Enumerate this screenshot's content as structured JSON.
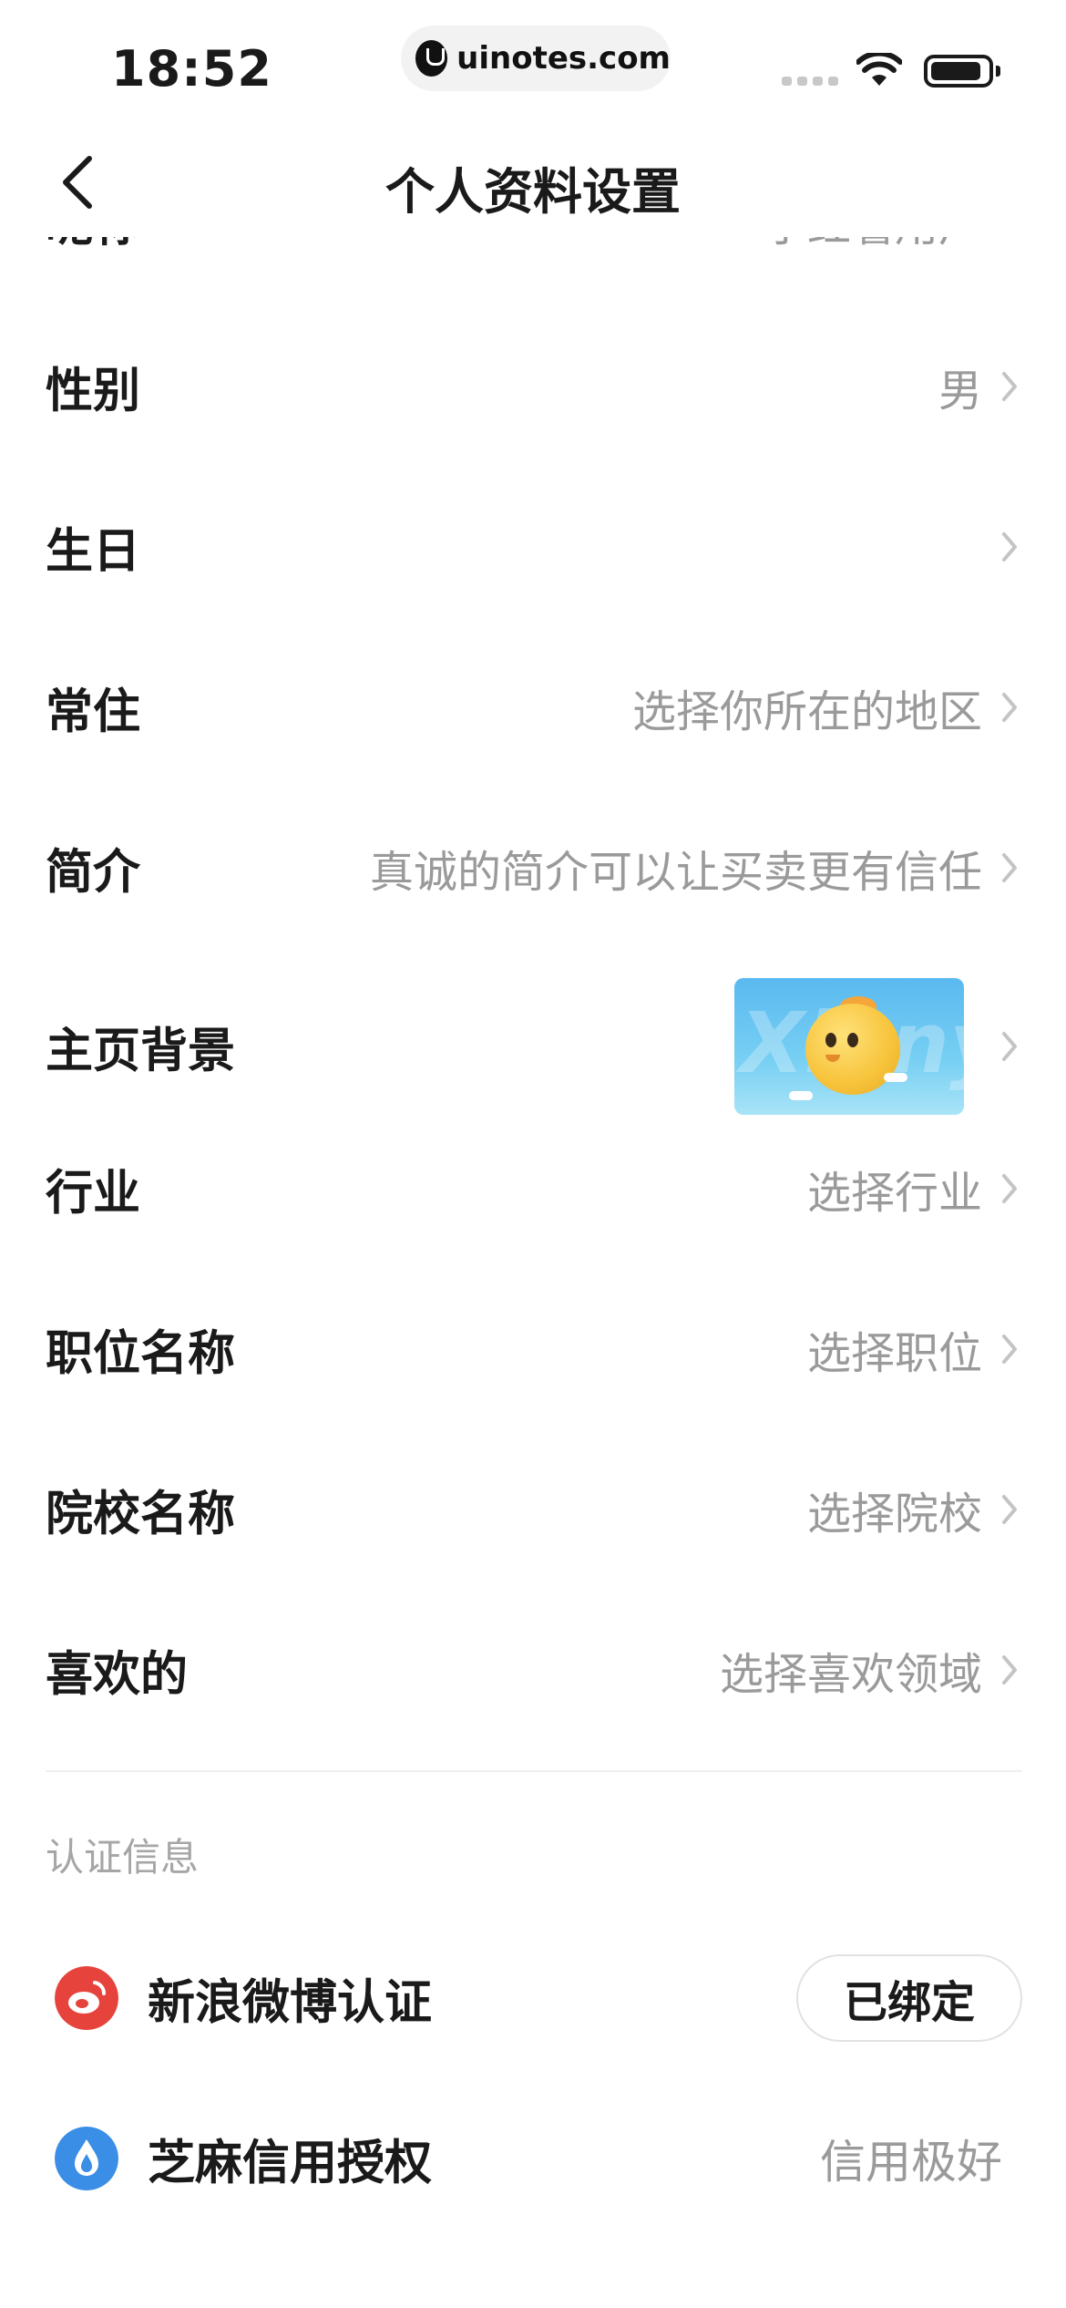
{
  "status_bar": {
    "time": "18:52",
    "url": "uinotes.com"
  },
  "nav": {
    "title": "个人资料设置"
  },
  "partial_row": {
    "label": "昵称",
    "value": "小红薯用户"
  },
  "rows": [
    {
      "label": "性别",
      "value": "男"
    },
    {
      "label": "生日",
      "value": ""
    },
    {
      "label": "常住",
      "value": "选择你所在的地区"
    },
    {
      "label": "简介",
      "value": "真诚的简介可以让买卖更有信任"
    },
    {
      "label": "主页背景",
      "value": ""
    },
    {
      "label": "行业",
      "value": "选择行业"
    },
    {
      "label": "职位名称",
      "value": "选择职位"
    },
    {
      "label": "院校名称",
      "value": "选择院校"
    },
    {
      "label": "喜欢的",
      "value": "选择喜欢领域"
    }
  ],
  "background_thumb": {
    "watermark": "Xianyu"
  },
  "auth": {
    "section_title": "认证信息",
    "weibo": {
      "label": "新浪微博认证",
      "button": "已绑定"
    },
    "zhima": {
      "label": "芝麻信用授权",
      "value": "信用极好"
    }
  },
  "colors": {
    "weibo": "#e6433d",
    "zhima": "#3a8ee6",
    "muted": "#9a9a9a"
  },
  "icons": [
    "back-arrow-icon",
    "chevron-right-icon",
    "weibo-icon",
    "zhima-icon",
    "wifi-icon",
    "battery-icon"
  ]
}
